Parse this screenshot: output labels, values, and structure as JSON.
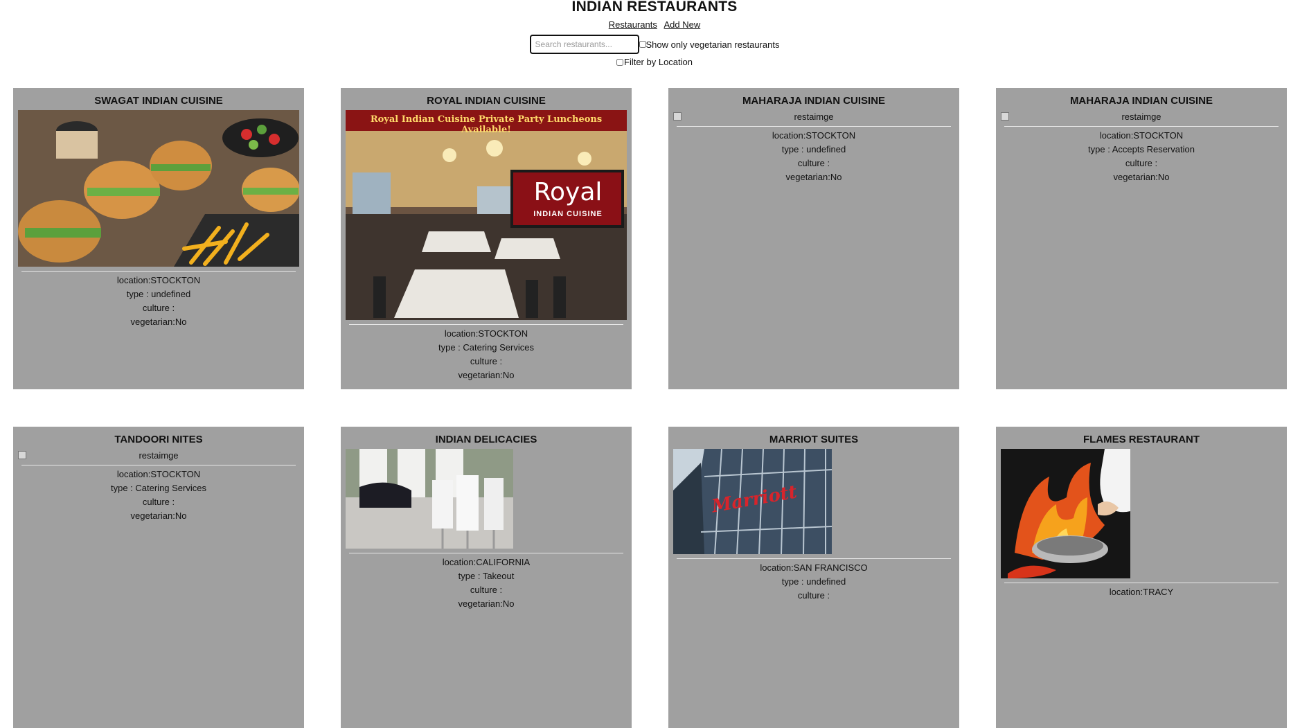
{
  "header": {
    "title": "INDIAN RESTAURANTS",
    "nav": {
      "restaurants": "Restaurants",
      "add_new": "Add New"
    },
    "search": {
      "placeholder": "Search restaurants...",
      "value": ""
    },
    "veg_filter_label": "Show only vegetarian restaurants",
    "location_filter_label": "Filter by Location"
  },
  "restaurants": [
    {
      "name": "SWAGAT INDIAN CUISINE",
      "image": "burger-platter-photo",
      "location": "location:STOCKTON",
      "type": "type : undefined",
      "culture": "culture :",
      "vegetarian": "vegetarian:No"
    },
    {
      "name": "ROYAL INDIAN CUISINE",
      "image": "restaurant-dining-room-photo",
      "banner": "Royal Indian Cuisine Private Party Luncheons Available!",
      "logo_main": "Royal",
      "logo_sub": "INDIAN CUISINE",
      "location": "location:STOCKTON",
      "type": "type : Catering Services",
      "culture": "culture :",
      "vegetarian": "vegetarian:No"
    },
    {
      "name": "MAHARAJA INDIAN CUISINE",
      "image_alt": "restaimge",
      "location": "location:STOCKTON",
      "type": "type : undefined",
      "culture": "culture :",
      "vegetarian": "vegetarian:No"
    },
    {
      "name": "MAHARAJA INDIAN CUISINE",
      "image_alt": "restaimge",
      "location": "location:STOCKTON",
      "type": "type : Accepts Reservation",
      "culture": "culture :",
      "vegetarian": "vegetarian:No"
    },
    {
      "name": "TANDOORI NITES",
      "image_alt": "restaimge",
      "location": "location:STOCKTON",
      "type": "type : Catering Services",
      "culture": "culture :",
      "vegetarian": "vegetarian:No"
    },
    {
      "name": "INDIAN DELICACIES",
      "image": "lounge-interior-photo",
      "location": "location:CALIFORNIA",
      "type": "type : Takeout",
      "culture": "culture :",
      "vegetarian": "vegetarian:No"
    },
    {
      "name": "MARRIOT SUITES",
      "image": "hotel-building-photo",
      "sign": "Marriott",
      "location": "location:SAN FRANCISCO",
      "type": "type : undefined",
      "culture": "culture :"
    },
    {
      "name": "FLAMES RESTAURANT",
      "image": "flaming-pan-photo",
      "location": "location:TRACY"
    }
  ]
}
